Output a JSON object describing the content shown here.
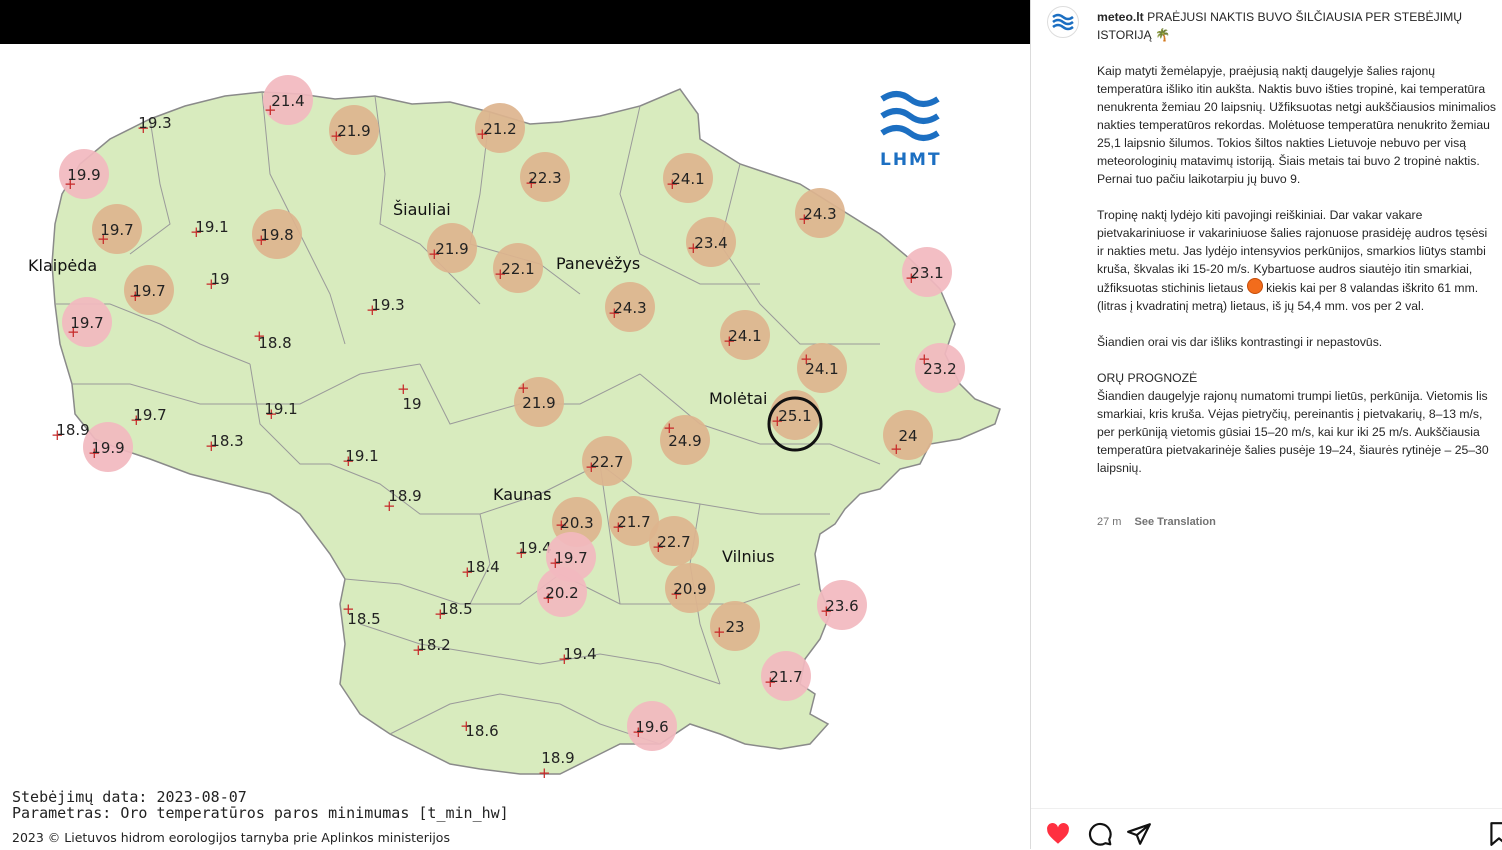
{
  "post": {
    "username": "meteo.lt",
    "title": "PRAĖJUSI NAKTIS BUVO ŠILČIAUSIA PER STEBĖJIMŲ ISTORIJĄ",
    "title_emoji": "🌴",
    "para1": "Kaip matyti žemėlapyje, praėjusią naktį daugelyje šalies rajonų temperatūra išliko itin aukšta. Naktis buvo išties tropinė, kai temperatūra nenukrenta žemiau 20 laipsnių. Užfiksuotas netgi aukščiausios minimalios nakties temperatūros rekordas. Molėtuose temperatūra nenukrito žemiau 25,1 laipsnio šilumos. Tokios šiltos nakties Lietuvoje nebuvo per visą meteorologinių matavimų istoriją. Šiais metais tai buvo 2 tropinė naktis. Pernai tuo pačiu laikotarpiu jų buvo 9.",
    "para2_a": "Tropinę naktį lydėjo kiti pavojingi reiškiniai. Dar vakar vakare pietvakariniuose ir vakariniuose šalies rajonuose prasidėję audros tęsėsi ir nakties metu. Jas lydėjo intensyvios perkūnijos, smarkios liūtys stambi kruša, škvalas iki 15-20 m/s. Kybartuose audros siautėjo itin smarkiai, užfiksuotas stichinis lietaus",
    "para2_b": "kiekis kai per 8 valandas iškrito 61 mm. (litras į kvadratinį metrą) lietaus, iš jų 54,4 mm. vos per 2 val.",
    "para3": "Šiandien orai vis dar išliks kontrastingi ir nepastovūs.",
    "forecast_heading": "ORŲ PROGNOZĖ",
    "forecast_text": "Šiandien daugelyje rajonų numatomi trumpi lietūs, perkūnija. Vietomis lis smarkiai, kris kruša. Vėjas pietryčių, pereinantis į pietvakarių, 8–13 m/s, per perkūniją vietomis gūsiai 15–20 m/s, kai kur iki 25 m/s. Aukščiausia temperatūra pietvakarinėje šalies pusėje 19–24, šiaurės rytinėje – 25–30 laipsnių.",
    "time_ago": "27 m",
    "see_translation": "See Translation"
  },
  "map": {
    "logo_text": "LHMT",
    "cities": [
      {
        "name": "Klaipėda"
      },
      {
        "name": "Šiauliai"
      },
      {
        "name": "Panevėžys"
      },
      {
        "name": "Molėtai"
      },
      {
        "name": "Kaunas"
      },
      {
        "name": "Vilnius"
      }
    ],
    "stations": [
      {
        "v": "21.4",
        "c": "pink"
      },
      {
        "v": "19.3",
        "c": "none"
      },
      {
        "v": "21.9",
        "c": "tan"
      },
      {
        "v": "21.2",
        "c": "tan"
      },
      {
        "v": "19.9",
        "c": "pink"
      },
      {
        "v": "22.3",
        "c": "tan"
      },
      {
        "v": "24.1",
        "c": "tan"
      },
      {
        "v": "24.3",
        "c": "tan"
      },
      {
        "v": "19.7",
        "c": "tan"
      },
      {
        "v": "19.1",
        "c": "none"
      },
      {
        "v": "19.8",
        "c": "tan"
      },
      {
        "v": "21.9",
        "c": "tan"
      },
      {
        "v": "22.1",
        "c": "tan"
      },
      {
        "v": "23.4",
        "c": "tan"
      },
      {
        "v": "23.1",
        "c": "pink"
      },
      {
        "v": "19.7",
        "c": "tan"
      },
      {
        "v": "19",
        "c": "none"
      },
      {
        "v": "19.3",
        "c": "none"
      },
      {
        "v": "24.3",
        "c": "tan"
      },
      {
        "v": "19.7",
        "c": "pink"
      },
      {
        "v": "18.8",
        "c": "none"
      },
      {
        "v": "24.1",
        "c": "tan"
      },
      {
        "v": "23.2",
        "c": "pink"
      },
      {
        "v": "24.1",
        "c": "tan"
      },
      {
        "v": "19.7",
        "c": "none"
      },
      {
        "v": "19.1",
        "c": "none"
      },
      {
        "v": "19",
        "c": "none"
      },
      {
        "v": "21.9",
        "c": "tan"
      },
      {
        "v": "25.1",
        "c": "tan"
      },
      {
        "v": "18.9",
        "c": "none"
      },
      {
        "v": "19.9",
        "c": "pink"
      },
      {
        "v": "18.3",
        "c": "none"
      },
      {
        "v": "24.9",
        "c": "tan"
      },
      {
        "v": "24",
        "c": "tan"
      },
      {
        "v": "19.1",
        "c": "none"
      },
      {
        "v": "22.7",
        "c": "tan"
      },
      {
        "v": "18.9",
        "c": "none"
      },
      {
        "v": "20.3",
        "c": "tan"
      },
      {
        "v": "21.7",
        "c": "tan"
      },
      {
        "v": "22.7",
        "c": "tan"
      },
      {
        "v": "19.4",
        "c": "none"
      },
      {
        "v": "19.7",
        "c": "pink"
      },
      {
        "v": "18.4",
        "c": "none"
      },
      {
        "v": "20.2",
        "c": "pink"
      },
      {
        "v": "20.9",
        "c": "tan"
      },
      {
        "v": "23.6",
        "c": "pink"
      },
      {
        "v": "18.5",
        "c": "none"
      },
      {
        "v": "18.5",
        "c": "none"
      },
      {
        "v": "23",
        "c": "tan"
      },
      {
        "v": "18.2",
        "c": "none"
      },
      {
        "v": "19.4",
        "c": "none"
      },
      {
        "v": "21.7",
        "c": "pink"
      },
      {
        "v": "18.6",
        "c": "none"
      },
      {
        "v": "19.6",
        "c": "pink"
      },
      {
        "v": "18.9",
        "c": "none"
      }
    ],
    "footer_date": "Stebėjimų data: 2023-08-07",
    "footer_param": "Parametras: Oro temperatūros paros minimumas [t_min_hw]",
    "footer_copy": "2023 © Lietuvos hidrom   eorologijos tarnyba prie Aplinkos ministerijos"
  },
  "colors": {
    "land": "#d8ebbe",
    "tan": "#ddb48e",
    "pink": "#f2b9bf",
    "cross": "#c62828"
  }
}
